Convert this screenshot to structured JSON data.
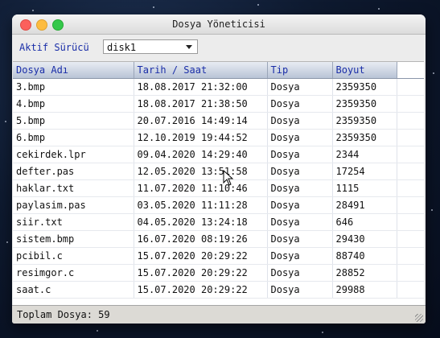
{
  "window": {
    "title": "Dosya Yöneticisi"
  },
  "toolbar": {
    "drive_label": "Aktif Sürücü",
    "drive_value": "disk1"
  },
  "table": {
    "columns": [
      "Dosya Adı",
      "Tarih / Saat",
      "Tip",
      "Boyut"
    ],
    "rows": [
      [
        "3.bmp",
        "18.08.2017 21:32:00",
        "Dosya",
        "2359350"
      ],
      [
        "4.bmp",
        "18.08.2017 21:38:50",
        "Dosya",
        "2359350"
      ],
      [
        "5.bmp",
        "20.07.2016 14:49:14",
        "Dosya",
        "2359350"
      ],
      [
        "6.bmp",
        "12.10.2019 19:44:52",
        "Dosya",
        "2359350"
      ],
      [
        "cekirdek.lpr",
        "09.04.2020 14:29:40",
        "Dosya",
        "2344"
      ],
      [
        "defter.pas",
        "12.05.2020 13:51:58",
        "Dosya",
        "17254"
      ],
      [
        "haklar.txt",
        "11.07.2020 11:10:46",
        "Dosya",
        "1115"
      ],
      [
        "paylasim.pas",
        "03.05.2020 11:11:28",
        "Dosya",
        "28491"
      ],
      [
        "siir.txt",
        "04.05.2020 13:24:18",
        "Dosya",
        "646"
      ],
      [
        "sistem.bmp",
        "16.07.2020 08:19:26",
        "Dosya",
        "29430"
      ],
      [
        "pcibil.c",
        "15.07.2020 20:29:22",
        "Dosya",
        "88740"
      ],
      [
        "resimgor.c",
        "15.07.2020 20:29:22",
        "Dosya",
        "28852"
      ],
      [
        "saat.c",
        "15.07.2020 20:29:22",
        "Dosya",
        "29988"
      ]
    ]
  },
  "status": {
    "text": "Toplam Dosya: 59"
  },
  "icons": [
    "close-icon",
    "minimize-icon",
    "maximize-icon",
    "chevron-down-icon",
    "resize-grip-icon",
    "mouse-cursor-icon"
  ]
}
